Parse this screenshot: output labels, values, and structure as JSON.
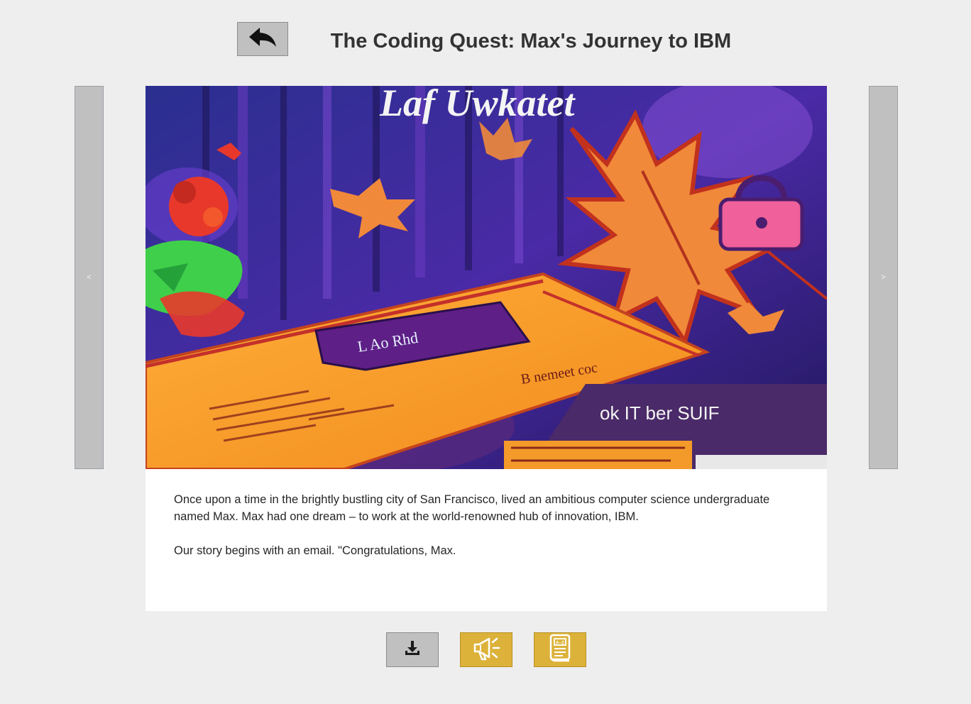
{
  "header": {
    "title": "The Coding Quest: Max's Journey to IBM",
    "back_icon": "back-arrow-icon"
  },
  "carousel": {
    "prev_label": "<",
    "next_label": ">"
  },
  "illustration": {
    "headline_text": "Laf Uwkatet",
    "card_badge_text": "L Ao Rhd",
    "card_right_text": "B nemeet coc",
    "lower_right_text": "ok IT ber SUIF",
    "colors": {
      "background": "#3b2a9c",
      "leaf": "#f0893a",
      "card": "#f49a2a",
      "badge": "#5e1f86",
      "green": "#3fcf4a",
      "red": "#e8382b"
    }
  },
  "story": {
    "paragraph_1": "Once upon a time in the brightly bustling city of San Francisco, lived an ambitious computer science undergraduate named Max. Max had one dream – to work at the world-renowned hub of innovation, IBM.",
    "paragraph_2": "Our story begins with an email. \"Congratulations, Max."
  },
  "toolbar": {
    "download_icon": "download-icon",
    "audio_icon": "megaphone-icon",
    "glossary_icon": "glossary-book-icon",
    "accent_color": "#ddb23a"
  }
}
